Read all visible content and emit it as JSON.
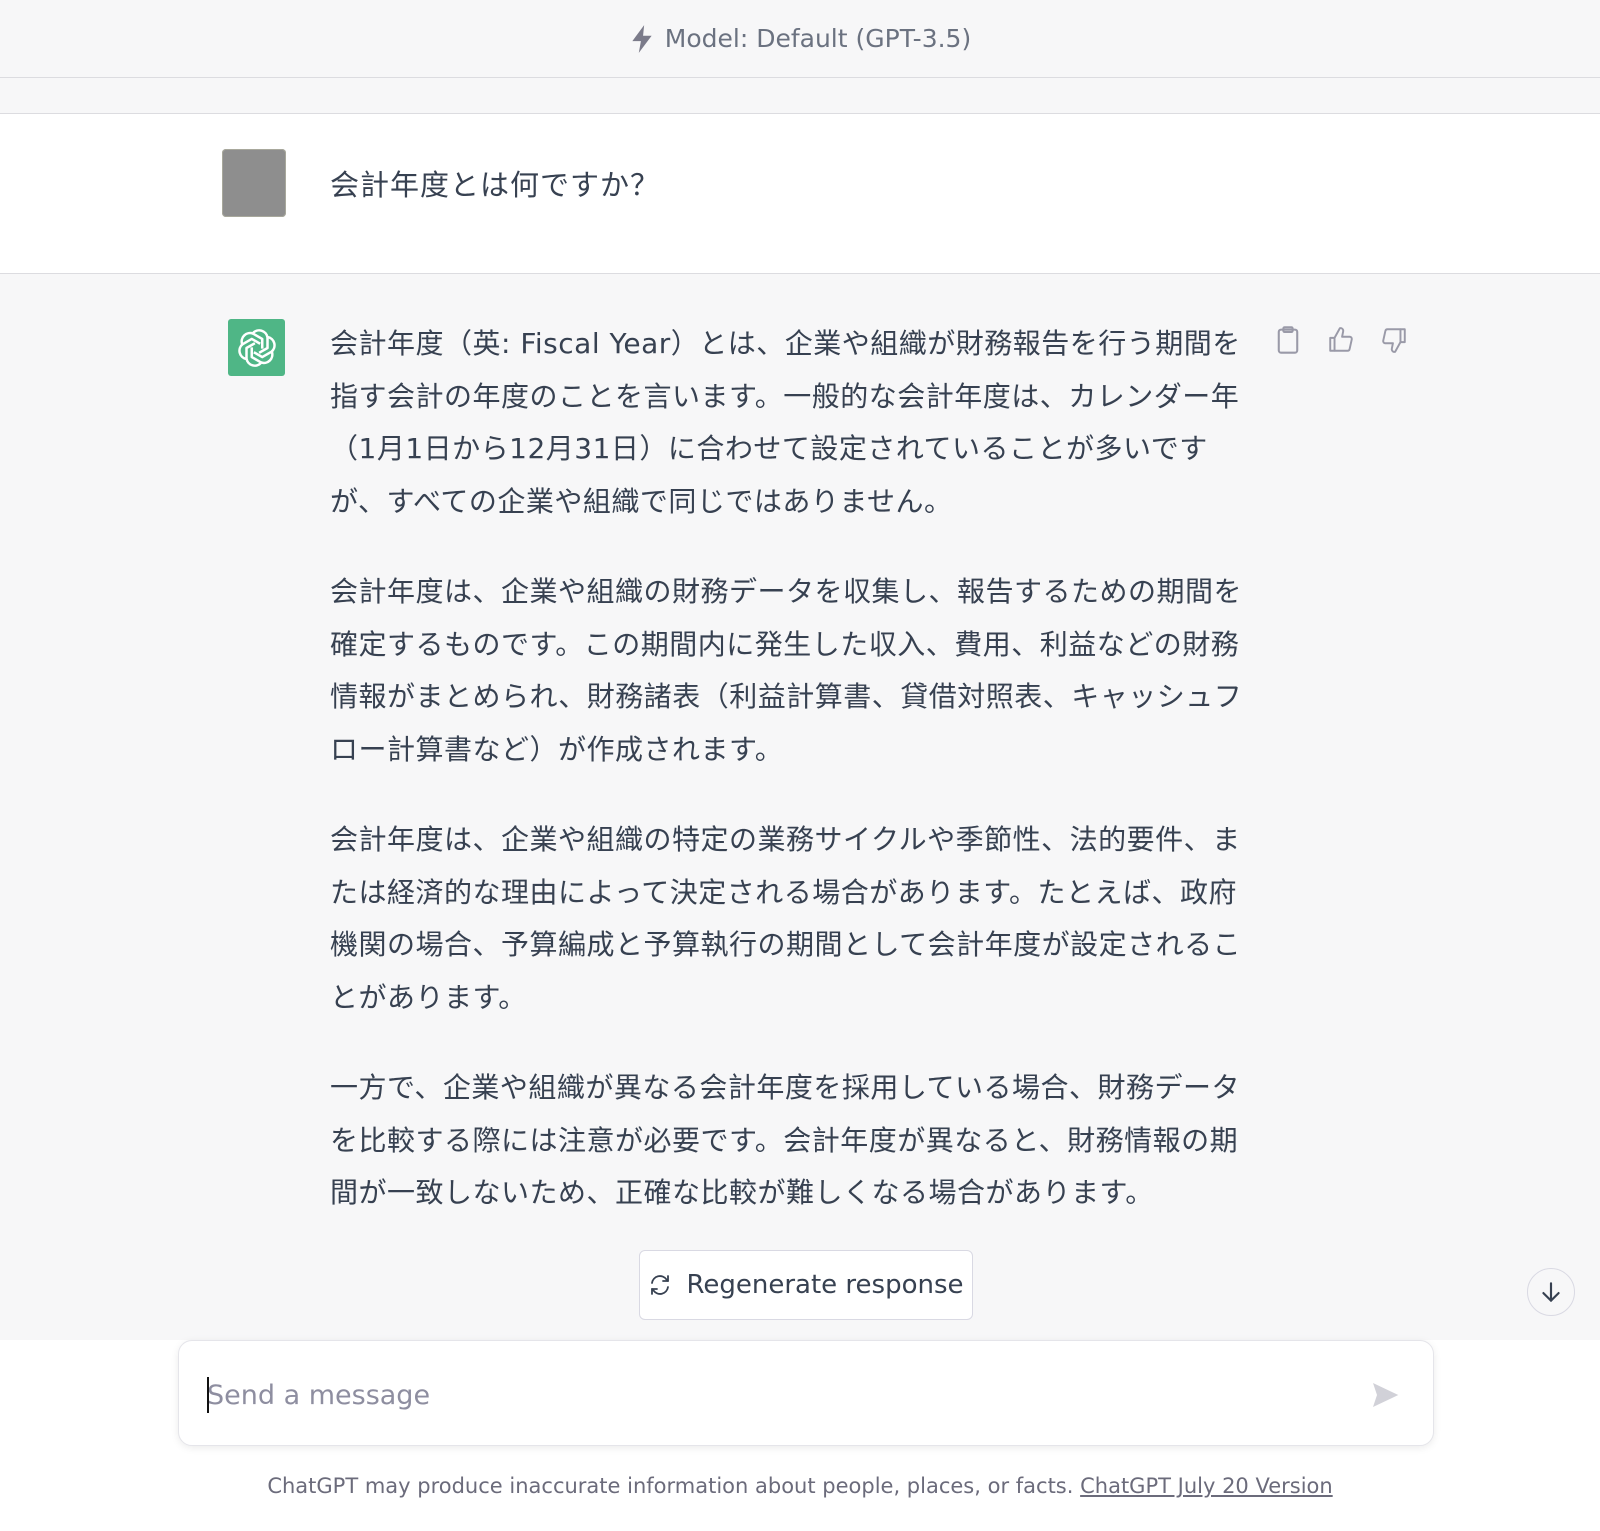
{
  "header": {
    "model_label": "Model: Default (GPT-3.5)",
    "icon": "bolt-icon"
  },
  "user_message": {
    "text": "会計年度とは何ですか？"
  },
  "assistant_message": {
    "paragraphs": [
      "会計年度（英: Fiscal Year）とは、企業や組織が財務報告を行う期間を指す会計の年度のことを言います。一般的な会計年度は、カレンダー年（1月1日から12月31日）に合わせて設定されていることが多いですが、すべての企業や組織で同じではありません。",
      "会計年度は、企業や組織の財務データを収集し、報告するための期間を確定するものです。この期間内に発生した収入、費用、利益などの財務情報がまとめられ、財務諸表（利益計算書、貸借対照表、キャッシュフロー計算書など）が作成されます。",
      "会計年度は、企業や組織の特定の業務サイクルや季節性、法的要件、または経済的な理由によって決定される場合があります。たとえば、政府機関の場合、予算編成と予算執行の期間として会計年度が設定されることがあります。",
      "一方で、企業や組織が異なる会計年度を採用している場合、財務データを比較する際には注意が必要です。会計年度が異なると、財務情報の期間が一致しないため、正確な比較が難しくなる場合があります。"
    ],
    "actions": [
      "clipboard-icon",
      "thumbs-up-icon",
      "thumbs-down-icon"
    ]
  },
  "regenerate": {
    "label": "Regenerate response"
  },
  "composer": {
    "placeholder": "Send a message"
  },
  "footer": {
    "disclaimer": "ChatGPT may produce inaccurate information about people, places, or facts.",
    "version_link": "ChatGPT July 20 Version"
  },
  "colors": {
    "gpt_avatar": "#4fb686",
    "background_alt": "#f7f7f8"
  }
}
